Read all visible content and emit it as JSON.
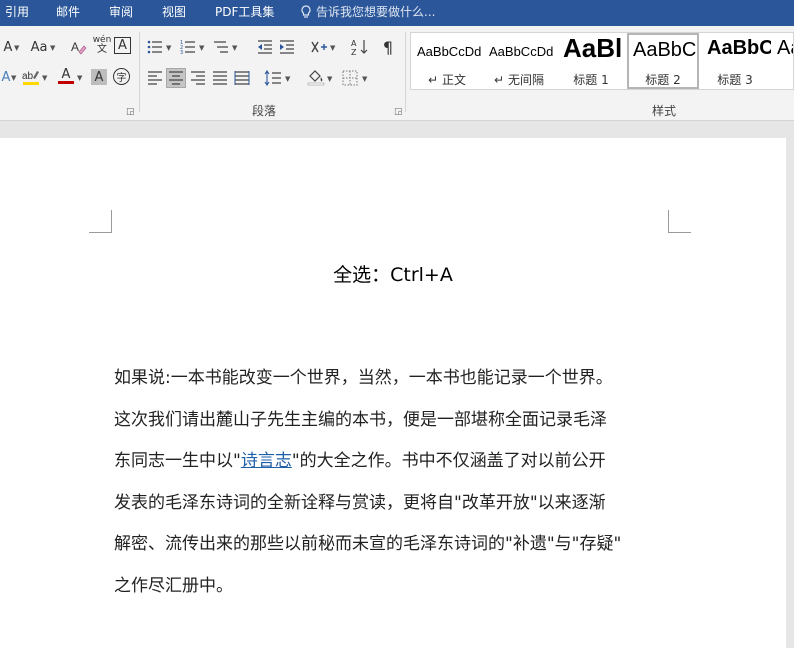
{
  "menu": {
    "tabs": [
      "引用",
      "邮件",
      "审阅",
      "视图",
      "PDF工具集"
    ],
    "tell_me": "告诉我您想要做什么..."
  },
  "ribbon": {
    "font": {
      "grow_shrink": "A",
      "change_case": "Aa",
      "phonetic": "wén",
      "char_border": "A",
      "font_color": "A",
      "char_shading": "A",
      "enclose": "字"
    },
    "paragraph": {
      "label": "段落"
    },
    "styles": {
      "label": "样式",
      "items": [
        {
          "preview": "AaBbCcDd",
          "name": "正文",
          "mark": "↵"
        },
        {
          "preview": "AaBbCcDd",
          "name": "无间隔",
          "mark": "↵"
        },
        {
          "preview": "AaBl",
          "name": "标题 1"
        },
        {
          "preview": "AaBbC",
          "name": "标题 2"
        },
        {
          "preview": "AaBbC",
          "name": "标题 3"
        },
        {
          "preview": "Aa"
        }
      ]
    }
  },
  "document": {
    "title": "全选：Ctrl+A",
    "lines": [
      "如果说:一本书能改变一个世界，当然，一本书也能记录一个世界。",
      "这次我们请出麓山子先生主编的本书，便是一部堪称全面记录毛泽",
      {
        "before": "东同志一生中以\"",
        "link": "诗言志",
        "after": "\"的大全之作。书中不仅涵盖了对以前公开"
      },
      "发表的毛泽东诗词的全新诠释与赏读，更将自\"改革开放\"以来逐渐",
      "解密、流传出来的那些以前秘而未宣的毛泽东诗词的\"补遗\"与\"存疑\"",
      "之作尽汇册中。"
    ]
  },
  "colors": {
    "menubar": "#2b579a",
    "link": "#1f5ea8",
    "font_color_bar": "#c00000",
    "highlight_bar": "#ffd800"
  }
}
